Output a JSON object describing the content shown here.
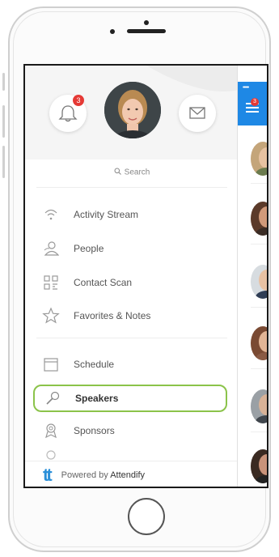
{
  "notifications": {
    "badge_count": "3"
  },
  "search": {
    "label": "Search"
  },
  "menu": {
    "items_primary": [
      {
        "label": "Activity Stream",
        "icon": "wifi-icon"
      },
      {
        "label": "People",
        "icon": "people-icon"
      },
      {
        "label": "Contact Scan",
        "icon": "qr-scan-icon"
      },
      {
        "label": "Favorites & Notes",
        "icon": "star-icon"
      }
    ],
    "items_secondary": [
      {
        "label": "Schedule",
        "icon": "calendar-icon"
      },
      {
        "label": "Speakers",
        "icon": "microphone-icon",
        "active": true
      },
      {
        "label": "Sponsors",
        "icon": "award-icon"
      }
    ]
  },
  "footer": {
    "logo": "tt",
    "powered_prefix": "Powered by",
    "powered_brand": "Attendify"
  },
  "right_panel": {
    "status_dots": "•••••",
    "badge_count": "3"
  },
  "colors": {
    "accent_blue": "#1e88e5",
    "active_green": "#8bc34a",
    "badge_red": "#e53935"
  }
}
